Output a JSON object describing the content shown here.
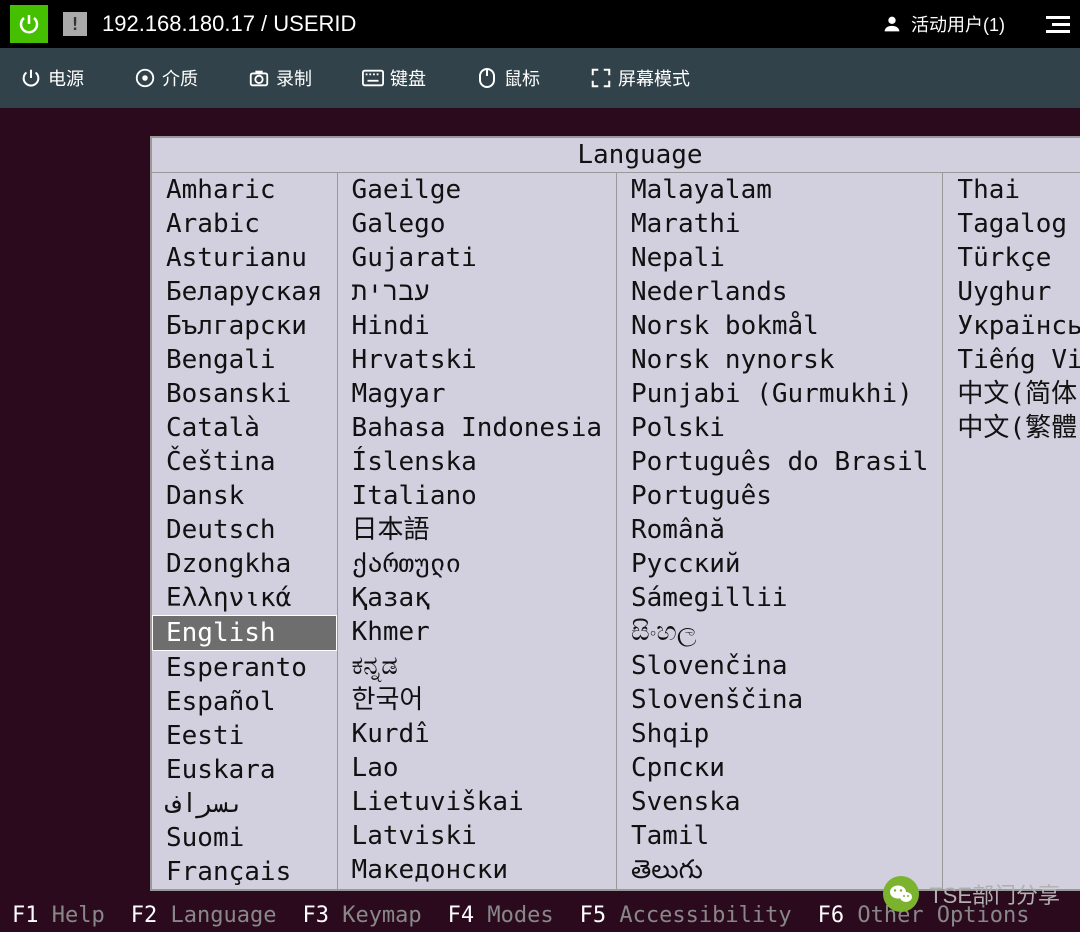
{
  "titlebar": {
    "address": "192.168.180.17 / USERID",
    "alert": "!",
    "user_label": "活动用户(1)"
  },
  "toolbar": {
    "power": "电源",
    "media": "介质",
    "record": "录制",
    "keyboard": "键盘",
    "mouse": "鼠标",
    "screen_mode": "屏幕模式"
  },
  "language_dialog": {
    "title": "Language",
    "selected": "English",
    "columns": [
      [
        "Amharic",
        "Arabic",
        "Asturianu",
        "Беларуская",
        "Български",
        "Bengali",
        "Bosanski",
        "Català",
        "Čeština",
        "Dansk",
        "Deutsch",
        "Dzongkha",
        "Ελληνικά",
        "English",
        "Esperanto",
        "Español",
        "Eesti",
        "Euskara",
        "ىسراف",
        "Suomi",
        "Français"
      ],
      [
        "Gaeilge",
        "Galego",
        "Gujarati",
        "עברית",
        "Hindi",
        "Hrvatski",
        "Magyar",
        "Bahasa Indonesia",
        "Íslenska",
        "Italiano",
        "日本語",
        "ქართული",
        "Қазақ",
        "Khmer",
        "ಕನ್ನಡ",
        "한국어",
        "Kurdî",
        "Lao",
        "Lietuviškai",
        "Latviski",
        "Македонски"
      ],
      [
        "Malayalam",
        "Marathi",
        "Nepali",
        "Nederlands",
        "Norsk bokmål",
        "Norsk nynorsk",
        "Punjabi (Gurmukhi)",
        "Polski",
        "Português do Brasil",
        "Português",
        "Română",
        "Русский",
        "Sámegillii",
        "සිංහල",
        "Slovenčina",
        "Slovenščina",
        "Shqip",
        "Српски",
        "Svenska",
        "Tamil",
        "తెలుగు"
      ],
      [
        "Thai",
        "Tagalog",
        "Türkçe",
        "Uyghur",
        "Українська",
        "Tiếng Việt",
        "中文(简体)",
        "中文(繁體)"
      ]
    ]
  },
  "footer": [
    {
      "key": "F1",
      "label": "Help"
    },
    {
      "key": "F2",
      "label": "Language"
    },
    {
      "key": "F3",
      "label": "Keymap"
    },
    {
      "key": "F4",
      "label": "Modes"
    },
    {
      "key": "F5",
      "label": "Accessibility"
    },
    {
      "key": "F6",
      "label": "Other Options"
    }
  ],
  "watermark": {
    "text": "TSE部门分享"
  }
}
